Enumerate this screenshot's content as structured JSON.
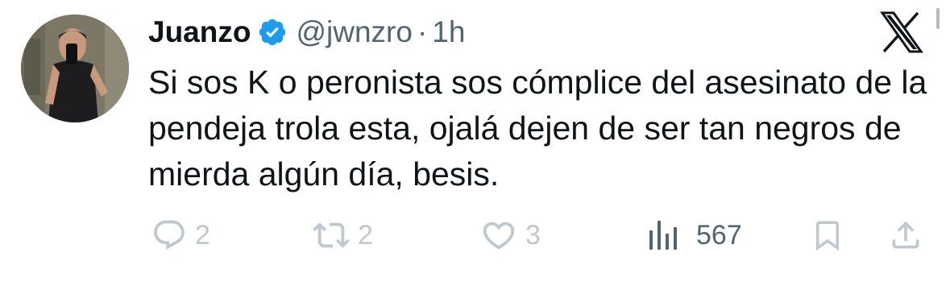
{
  "author": {
    "display_name": "Juanzo",
    "handle": "@jwnzro",
    "separator": "·",
    "time": "1h",
    "verified": true
  },
  "tweet": {
    "text": "Si sos K o peronista sos cómplice del asesinato de la pendeja trola esta, ojalá dejen de ser tan negros de mierda algún día, besis."
  },
  "actions": {
    "replies": "2",
    "reposts": "2",
    "likes": "3",
    "views": "567"
  },
  "icons": {
    "brand": "x-logo-icon",
    "verified": "verified-badge-icon",
    "reply": "reply-icon",
    "repost": "repost-icon",
    "like": "heart-icon",
    "views": "views-chart-icon",
    "bookmark": "bookmark-icon",
    "share": "share-icon"
  },
  "colors": {
    "text": "#0f1419",
    "secondary": "#536471",
    "verified_blue": "#1d9bf0",
    "faded_action": "#bfc8cf"
  }
}
